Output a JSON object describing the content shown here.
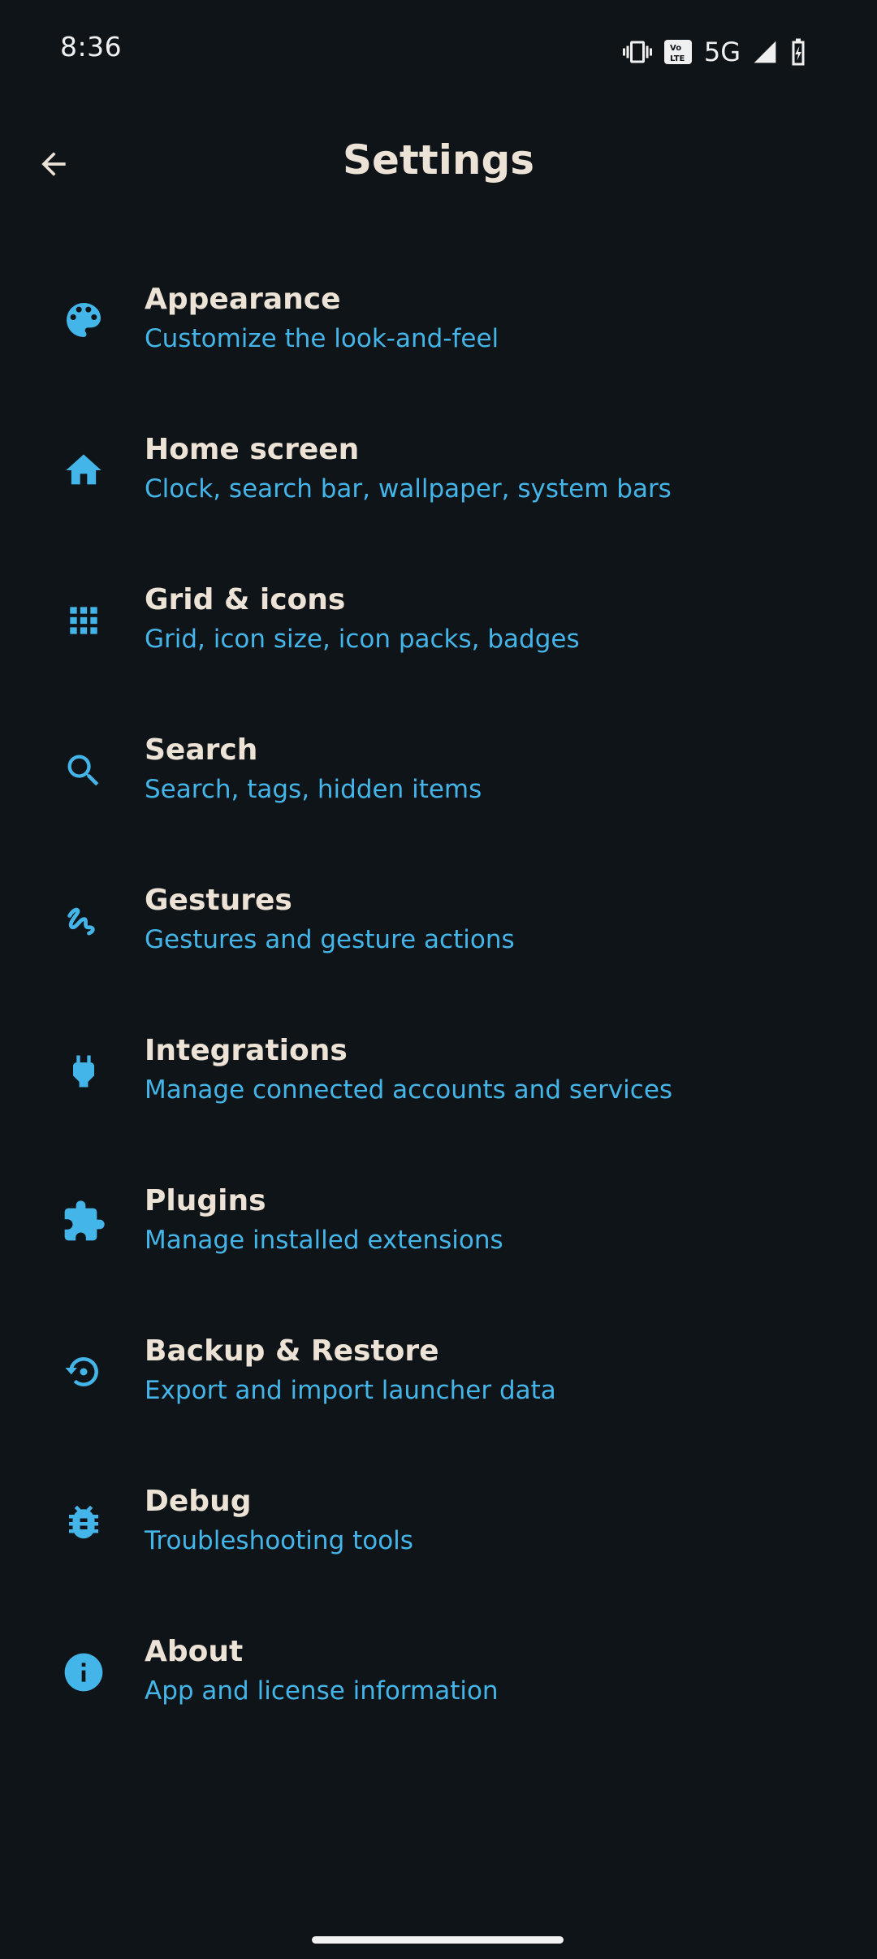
{
  "status_bar": {
    "time": "8:36",
    "network": "5G",
    "icons": [
      "vibrate-icon",
      "volte-icon",
      "signal-icon",
      "battery-charging-icon"
    ]
  },
  "header": {
    "title": "Settings",
    "back_icon": "arrow-back-icon"
  },
  "colors": {
    "background": "#0f1418",
    "accent": "#44b5e8",
    "title_text": "#ece3d6"
  },
  "settings": {
    "items": [
      {
        "title": "Appearance",
        "subtitle": "Customize the look-and-feel",
        "icon": "palette-icon"
      },
      {
        "title": "Home screen",
        "subtitle": "Clock, search bar, wallpaper, system bars",
        "icon": "home-icon"
      },
      {
        "title": "Grid & icons",
        "subtitle": "Grid, icon size, icon packs, badges",
        "icon": "grid-icon"
      },
      {
        "title": "Search",
        "subtitle": "Search, tags, hidden items",
        "icon": "search-icon"
      },
      {
        "title": "Gestures",
        "subtitle": "Gestures and gesture actions",
        "icon": "gesture-icon"
      },
      {
        "title": "Integrations",
        "subtitle": "Manage connected accounts and services",
        "icon": "plug-icon"
      },
      {
        "title": "Plugins",
        "subtitle": "Manage installed extensions",
        "icon": "puzzle-icon"
      },
      {
        "title": "Backup & Restore",
        "subtitle": "Export and import launcher data",
        "icon": "restore-icon"
      },
      {
        "title": "Debug",
        "subtitle": "Troubleshooting tools",
        "icon": "bug-icon"
      },
      {
        "title": "About",
        "subtitle": "App and license information",
        "icon": "info-icon"
      }
    ]
  }
}
